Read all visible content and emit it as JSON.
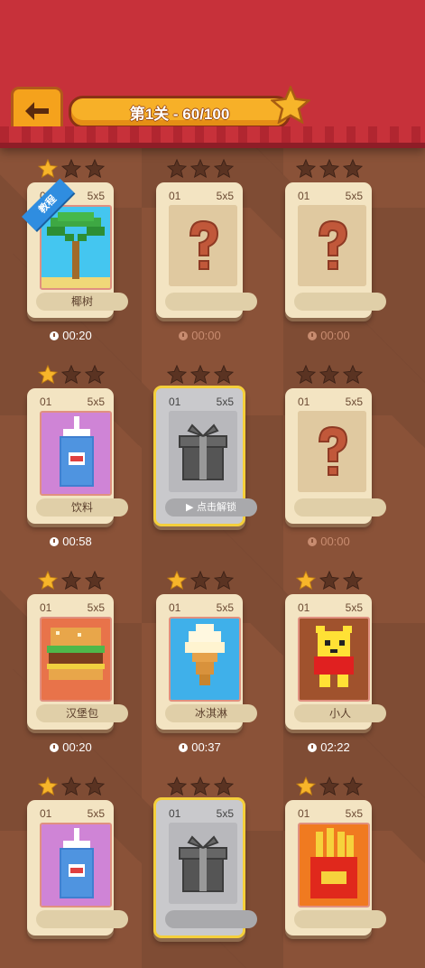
{
  "header": {
    "back_icon": "back-arrow-icon",
    "progress_text": "第1关 - 60/100",
    "star_icon": "star-icon"
  },
  "colors": {
    "star_on": "#f7b52a",
    "star_off": "#5a3322",
    "header_red": "#c7313a"
  },
  "levels": [
    {
      "num": "01",
      "size": "5x5",
      "label": "椰树",
      "stars": 1,
      "time": "00:20",
      "state": "done",
      "pic": "palm-tree",
      "badge": "教程"
    },
    {
      "num": "01",
      "size": "5x5",
      "label": "",
      "stars": 0,
      "time": "00:00",
      "state": "unknown"
    },
    {
      "num": "01",
      "size": "5x5",
      "label": "",
      "stars": 0,
      "time": "00:00",
      "state": "unknown"
    },
    {
      "num": "01",
      "size": "5x5",
      "label": "饮料",
      "stars": 1,
      "time": "00:58",
      "state": "done",
      "pic": "drink"
    },
    {
      "num": "01",
      "size": "5x5",
      "label": "点击解锁",
      "stars": 0,
      "time": "",
      "state": "gift"
    },
    {
      "num": "01",
      "size": "5x5",
      "label": "",
      "stars": 0,
      "time": "00:00",
      "state": "unknown"
    },
    {
      "num": "01",
      "size": "5x5",
      "label": "汉堡包",
      "stars": 1,
      "time": "00:20",
      "state": "done",
      "pic": "burger"
    },
    {
      "num": "01",
      "size": "5x5",
      "label": "冰淇淋",
      "stars": 1,
      "time": "00:37",
      "state": "done",
      "pic": "icecream"
    },
    {
      "num": "01",
      "size": "5x5",
      "label": "小人",
      "stars": 1,
      "time": "02:22",
      "state": "done",
      "pic": "bear"
    },
    {
      "num": "01",
      "size": "5x5",
      "label": "",
      "stars": 1,
      "time": "",
      "state": "done",
      "pic": "drink"
    },
    {
      "num": "01",
      "size": "5x5",
      "label": "",
      "stars": 0,
      "time": "",
      "state": "gift"
    },
    {
      "num": "01",
      "size": "5x5",
      "label": "",
      "stars": 1,
      "time": "",
      "state": "done",
      "pic": "fries"
    }
  ]
}
